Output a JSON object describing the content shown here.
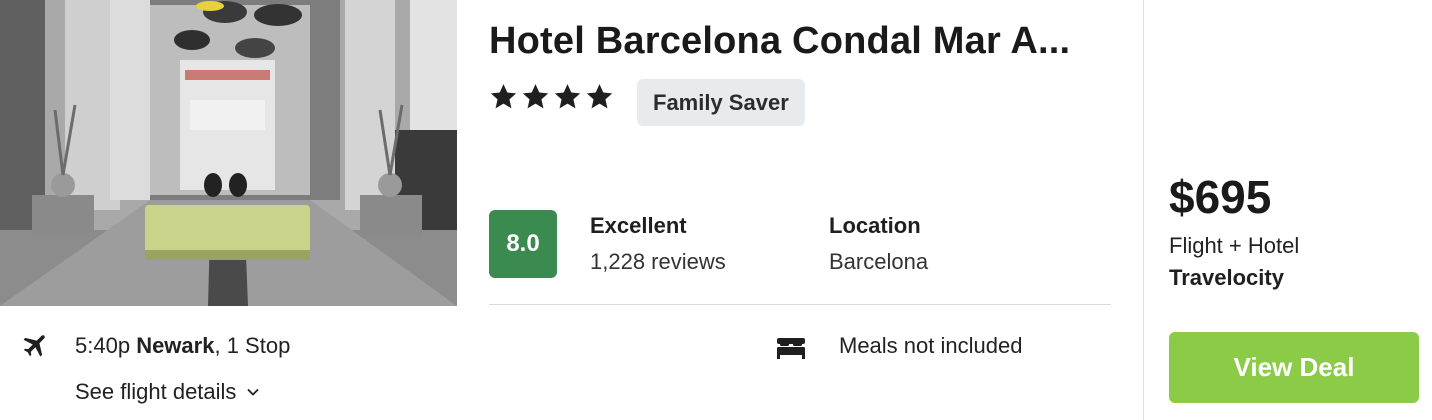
{
  "hotel": {
    "name": "Hotel Barcelona Condal Mar A...",
    "star_count": 4,
    "tag": "Family Saver",
    "score": "8.0",
    "rating_label": "Excellent",
    "review_count": "1,228 reviews",
    "location_label": "Location",
    "location_value": "Barcelona"
  },
  "flight": {
    "time": "5:40p",
    "origin": "Newark",
    "stops": ", 1 Stop",
    "details_link": "See flight details"
  },
  "amenity": {
    "meals": "Meals not included"
  },
  "offer": {
    "price": "$695",
    "package": "Flight + Hotel",
    "provider": "Travelocity",
    "button_label": "View Deal"
  },
  "icons": {
    "flight": "airplane-icon",
    "meals": "bed-icon",
    "details": "chevron-down-icon",
    "rating": "star-icon"
  },
  "colors": {
    "score_bg": "#3b8a4f",
    "button_bg": "#8ccb48",
    "badge_bg": "#e8ebee"
  }
}
